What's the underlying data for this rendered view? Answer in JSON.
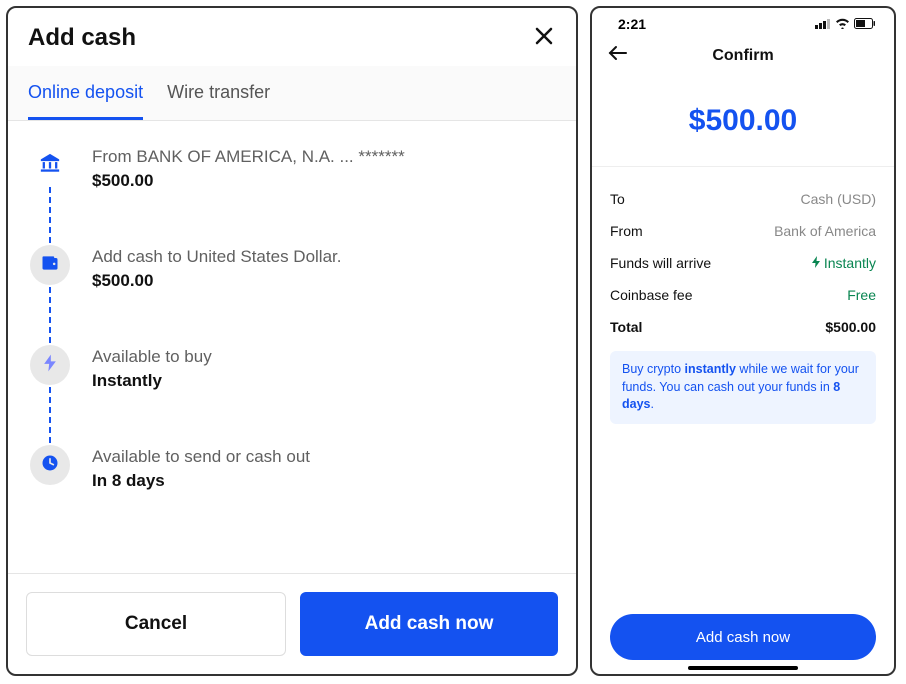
{
  "left": {
    "title": "Add cash",
    "tabs": [
      "Online deposit",
      "Wire transfer"
    ],
    "steps": [
      {
        "label": "From BANK OF AMERICA, N.A. ... *******",
        "value": "$500.00"
      },
      {
        "label": "Add cash to United States Dollar.",
        "value": "$500.00"
      },
      {
        "label": "Available to buy",
        "value": "Instantly"
      },
      {
        "label": "Available to send or cash out",
        "value": "In 8 days"
      }
    ],
    "cancel": "Cancel",
    "submit": "Add cash now"
  },
  "right": {
    "time": "2:21",
    "title": "Confirm",
    "amount": "$500.00",
    "rows": {
      "to_label": "To",
      "to_value": "Cash (USD)",
      "from_label": "From",
      "from_value": "Bank of America",
      "arrive_label": "Funds will arrive",
      "arrive_value": "Instantly",
      "fee_label": "Coinbase fee",
      "fee_value": "Free",
      "total_label": "Total",
      "total_value": "$500.00"
    },
    "info_pre": "Buy crypto ",
    "info_bold1": "instantly",
    "info_mid": " while we wait for your funds. You can cash out your funds in ",
    "info_bold2": "8 days",
    "info_post": ".",
    "submit": "Add cash now"
  }
}
